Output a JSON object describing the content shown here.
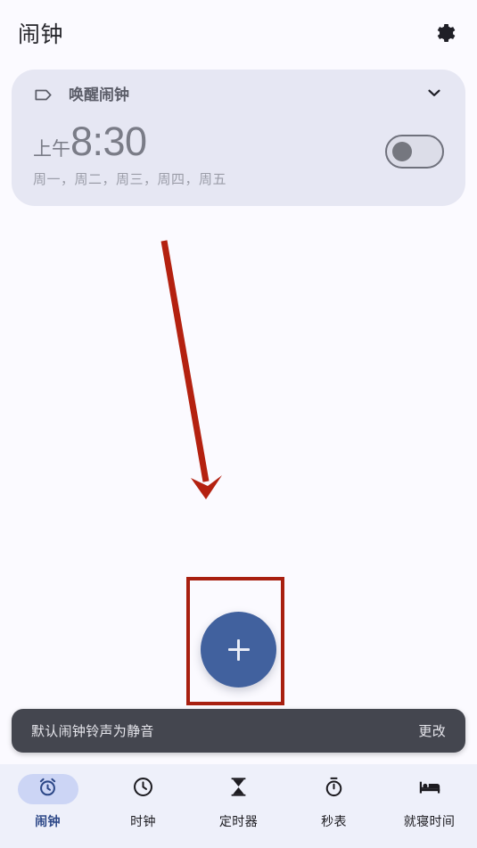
{
  "appbar": {
    "title": "闹钟",
    "settings_icon": "gear-icon"
  },
  "alarm_card": {
    "tag_icon": "tag-icon",
    "label": "唤醒闹钟",
    "expand_icon": "chevron-down-icon",
    "time_ampm": "上午",
    "time_value": "8:30",
    "days": "周一，周二，周三，周四，周五",
    "enabled": false
  },
  "fab": {
    "icon": "plus-icon",
    "label": "+"
  },
  "snackbar": {
    "message": "默认闹钟铃声为静音",
    "action_label": "更改"
  },
  "bottom_nav": {
    "items": [
      {
        "label": "闹钟",
        "icon": "alarm-clock-icon",
        "active": true
      },
      {
        "label": "时钟",
        "icon": "clock-icon",
        "active": false
      },
      {
        "label": "定时器",
        "icon": "hourglass-icon",
        "active": false
      },
      {
        "label": "秒表",
        "icon": "stopwatch-icon",
        "active": false
      },
      {
        "label": "就寝时间",
        "icon": "bed-icon",
        "active": false
      }
    ]
  },
  "annotations": {
    "highlight_box": "red-highlight-box",
    "pointer_arrow": "red-pointer-arrow",
    "color": "#a81f10"
  }
}
